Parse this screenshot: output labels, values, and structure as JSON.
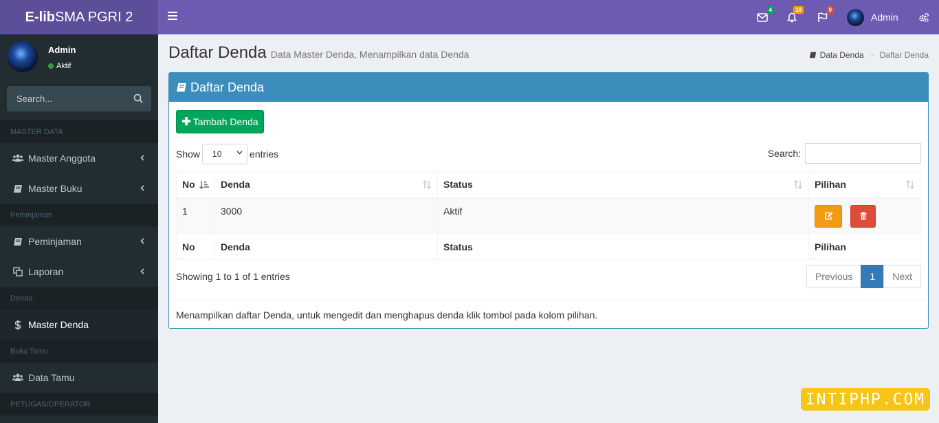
{
  "app": {
    "logo_bold": "E-lib",
    "logo_rest": "SMA PGRI 2"
  },
  "navbar": {
    "messages_count": "4",
    "notifications_count": "10",
    "tasks_count": "9",
    "user_name": "Admin",
    "colors": {
      "messages_badge": "#00a65a",
      "notifications_badge": "#f39c12",
      "tasks_badge": "#dd4b39"
    }
  },
  "sidebar": {
    "user_name": "Admin",
    "user_status": "Aktif",
    "search_placeholder": "Search...",
    "sections": [
      {
        "header": "MASTER DATA",
        "items": [
          {
            "label": "Master Anggota",
            "icon": "users-icon"
          },
          {
            "label": "Master Buku",
            "icon": "book-icon"
          }
        ]
      },
      {
        "header": "Peminjaman",
        "items": [
          {
            "label": "Peminjaman",
            "icon": "book-icon"
          },
          {
            "label": "Laporan",
            "icon": "copy-icon"
          }
        ]
      },
      {
        "header": "Denda",
        "items": [
          {
            "label": "Master Denda",
            "icon": "dollar-icon"
          }
        ]
      },
      {
        "header": "Buku Tamu",
        "items": [
          {
            "label": "Data Tamu",
            "icon": "users-icon"
          }
        ]
      },
      {
        "header": "PETUGAS/OPERATOR",
        "items": []
      }
    ]
  },
  "page": {
    "title": "Daftar Denda",
    "subtitle": "Data Master Denda, Menampilkan data Denda",
    "breadcrumb": [
      "Data Denda",
      "Daftar Denda"
    ]
  },
  "box": {
    "title": "Daftar Denda",
    "add_button": "Tambah Denda",
    "show_label": "Show",
    "entries_value": "10",
    "entries_label": "entries",
    "search_label": "Search:",
    "columns": [
      "No",
      "Denda",
      "Status",
      "Pilihan"
    ],
    "rows": [
      {
        "no": "1",
        "denda": "3000",
        "status": "Aktif"
      }
    ],
    "info": "Showing 1 to 1 of 1 entries",
    "pagination": {
      "previous": "Previous",
      "current": "1",
      "next": "Next"
    },
    "footer_note": "Menampilkan daftar Denda, untuk mengedit dan menghapus denda klik tombol pada kolom pilihan."
  },
  "watermark": "INTIPHP.COM",
  "colors": {
    "navbar": "#6c5bb0",
    "logo_bg": "#5d4e9a",
    "sidebar": "#222d32",
    "primary": "#3c8dbc",
    "success": "#00a65a",
    "warning": "#f39c12",
    "danger": "#dd4b39"
  }
}
